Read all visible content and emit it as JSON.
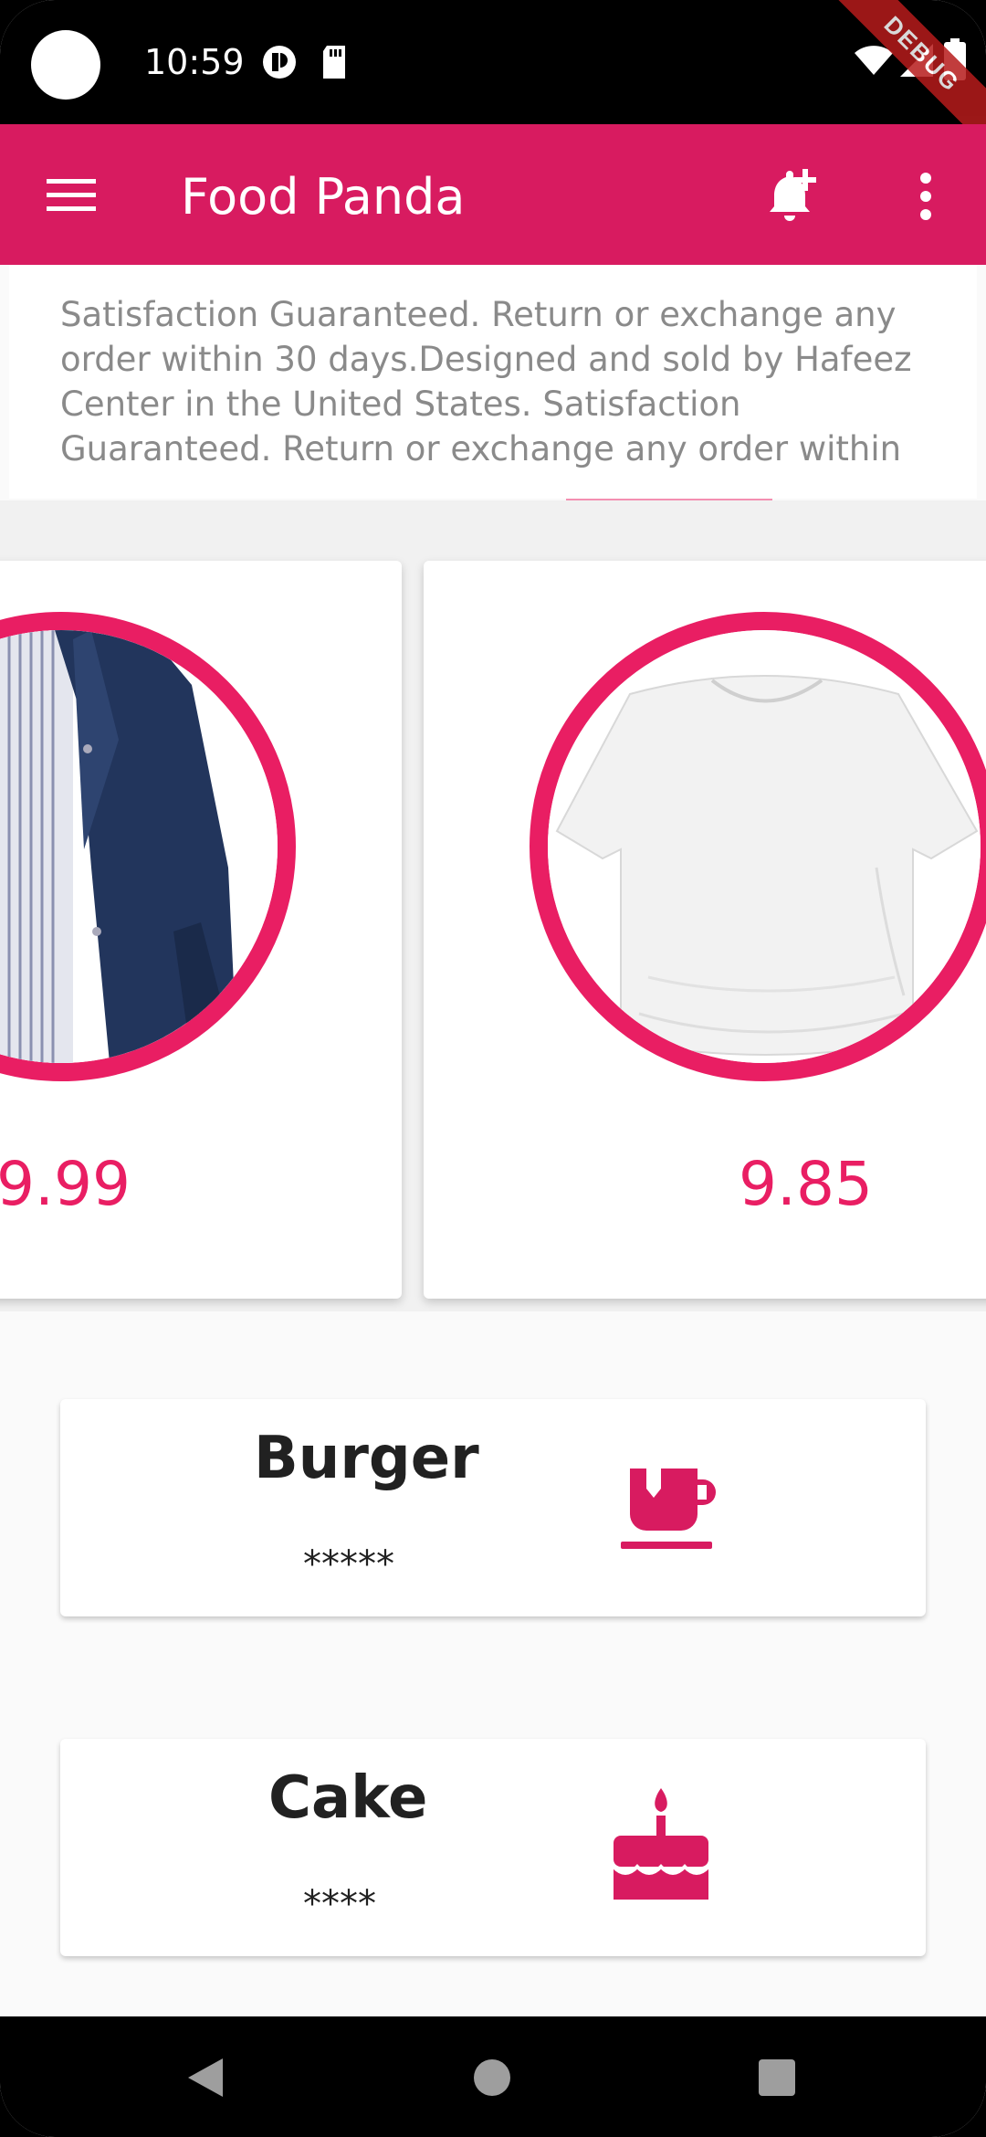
{
  "status_bar": {
    "time": "10:59",
    "debug_label": "DEBUG"
  },
  "app_bar": {
    "title": "Food Panda"
  },
  "description": {
    "text": "Satisfaction Guaranteed. Return or exchange any order within 30 days.Designed and sold by Hafeez Center in the United States. Satisfaction Guaranteed. Return or exchange any order within"
  },
  "products": [
    {
      "name": "jacket",
      "price": "9.99"
    },
    {
      "name": "t-shirt",
      "price": "9.85"
    }
  ],
  "categories": [
    {
      "title": "Burger",
      "rating": "*****",
      "icon": "coffee-cup-icon"
    },
    {
      "title": "Cake",
      "rating": "****",
      "icon": "cake-icon"
    }
  ],
  "colors": {
    "primary": "#d81b60",
    "accent": "#e91e63"
  }
}
